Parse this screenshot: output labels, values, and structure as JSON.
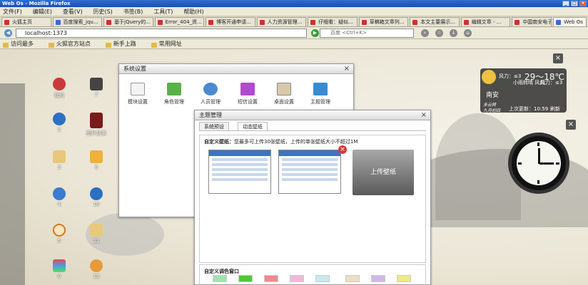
{
  "window": {
    "title": "Web Os - Mozilla Firefox"
  },
  "menu": [
    "文件(F)",
    "编辑(E)",
    "查看(V)",
    "历史(S)",
    "书签(B)",
    "工具(T)",
    "帮助(H)"
  ],
  "tabs": [
    {
      "label": "火狐主页"
    },
    {
      "label": "百度搜索_jqu..."
    },
    {
      "label": "基于jQuery的..."
    },
    {
      "label": "Error_404_资..."
    },
    {
      "label": "博客开通申请..."
    },
    {
      "label": "人力资源管理..."
    },
    {
      "label": "仔细看：疑似..."
    },
    {
      "label": "草稿箱文章列..."
    },
    {
      "label": "本文主要展示..."
    },
    {
      "label": "编辑文章 - ..."
    },
    {
      "label": "中国南安电子..."
    },
    {
      "label": "Web Os"
    }
  ],
  "nav": {
    "url": "localhost:1373",
    "search_placeholder": "百度 <Ctrl+K>"
  },
  "bookmarks": [
    "访问最多",
    "火狐官方站点",
    "新手上路",
    "常用网址"
  ],
  "desktop_icons": [
    {
      "label": "我的"
    },
    {
      "label": "7"
    },
    {
      "label": "2"
    },
    {
      "label": "图片故事"
    },
    {
      "label": "3"
    },
    {
      "label": "9"
    },
    {
      "label": "4"
    },
    {
      "label": "10"
    },
    {
      "label": "5"
    },
    {
      "label": "11"
    },
    {
      "label": "6"
    },
    {
      "label": "12"
    }
  ],
  "system_window": {
    "title": "系统设置",
    "items": [
      "模块设置",
      "角色管理",
      "人员管理",
      "短信设置",
      "桌面设置",
      "主题管理"
    ]
  },
  "theme_window": {
    "title": "主题管理",
    "tabs": [
      "系统预设",
      "动态壁纸"
    ],
    "custom_wallpaper_label": "自定义壁纸：",
    "custom_wallpaper_hint": "您最多可上传30张壁纸，上传的单张壁纸大小不超过1M",
    "upload_label": "上传壁纸",
    "custom_color_label": "自定义调色窗口"
  },
  "weather": {
    "city": "南安",
    "wind1": "风力：≤3",
    "wind2": "风力：≤3",
    "temp": "29～18℃",
    "desc": "小雨转晴 风向：",
    "line1": "多云转",
    "line2": "九月初四",
    "update": "上次更新：10:59",
    "refresh": "刷新"
  },
  "colors": {
    "swatches": [
      "#9fe3b0",
      "#4ec838",
      "#f08a8a",
      "#f3b8d8",
      "#c8e8f0",
      "#f0dcc0",
      "#d0b8e8",
      "#f0e88a"
    ]
  }
}
